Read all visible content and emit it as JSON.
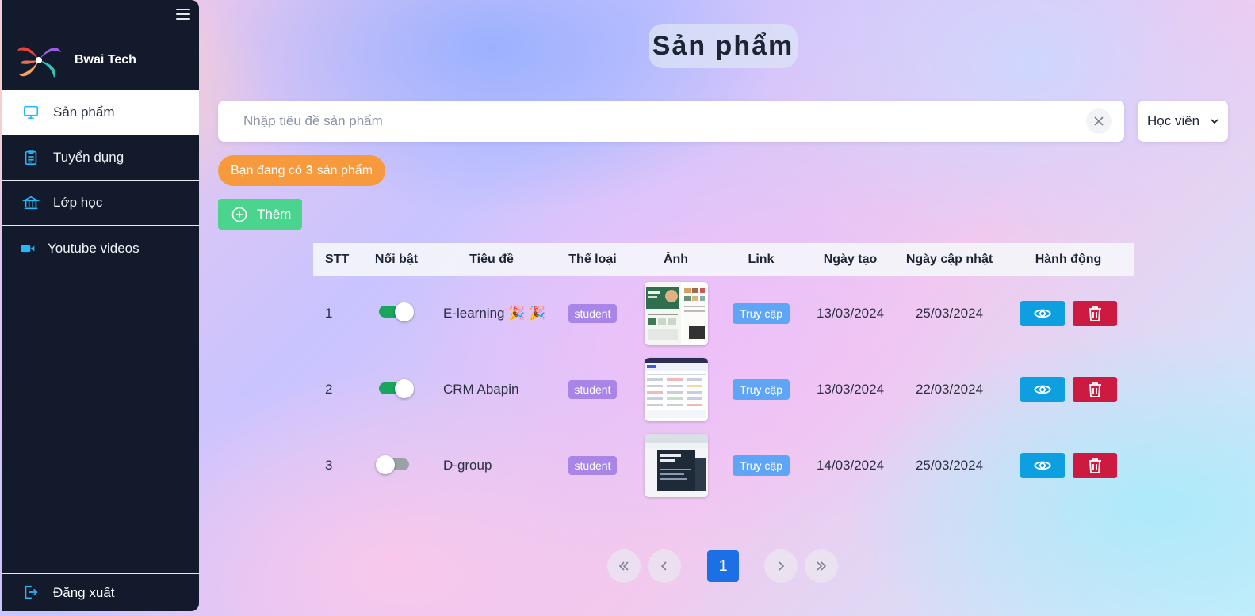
{
  "sidebar": {
    "brand_name": "Bwai Tech",
    "items": [
      {
        "label": "Sản phẩm",
        "icon": "monitor-icon",
        "active": true
      },
      {
        "label": "Tuyển dụng",
        "icon": "clipboard-icon"
      },
      {
        "label": "Lớp học",
        "icon": "bank-building-icon"
      },
      {
        "label": "Youtube videos",
        "icon": "video-camera-icon"
      }
    ],
    "logout_label": "Đăng xuất"
  },
  "page": {
    "title": "Sản phẩm"
  },
  "search": {
    "placeholder": "Nhập tiêu đề sản phẩm",
    "value": ""
  },
  "role_filter": {
    "selected": "Học viên"
  },
  "count_badge": {
    "prefix": "Bạn đang có",
    "count": "3",
    "suffix": "sản phẩm"
  },
  "add_button": {
    "label": "Thêm"
  },
  "table": {
    "columns": [
      "STT",
      "Nổi bật",
      "Tiêu đề",
      "Thể loại",
      "Ảnh",
      "Link",
      "Ngày tạo",
      "Ngày cập nhật",
      "Hành động"
    ],
    "rows": [
      {
        "stt": "1",
        "featured": true,
        "title": "E-learning 🎉 🎉",
        "category": "student",
        "link_label": "Truy cập",
        "created": "13/03/2024",
        "updated": "25/03/2024"
      },
      {
        "stt": "2",
        "featured": true,
        "title": "CRM Abapin",
        "category": "student",
        "link_label": "Truy cập",
        "created": "13/03/2024",
        "updated": "22/03/2024"
      },
      {
        "stt": "3",
        "featured": false,
        "title": "D-group",
        "category": "student",
        "link_label": "Truy cập",
        "created": "14/03/2024",
        "updated": "25/03/2024"
      }
    ]
  },
  "pagination": {
    "current_page": "1"
  },
  "colors": {
    "sidebar_bg": "#121a2b",
    "badge_orange": "#f79a3e",
    "add_green": "#4ad48e",
    "toggle_on": "#1aa55c",
    "tag_purple": "#a985e8",
    "link_blue": "#5ea6f5",
    "view_blue": "#0d9fe0",
    "delete_red": "#cd1a41",
    "page_active": "#1c6fe4"
  }
}
